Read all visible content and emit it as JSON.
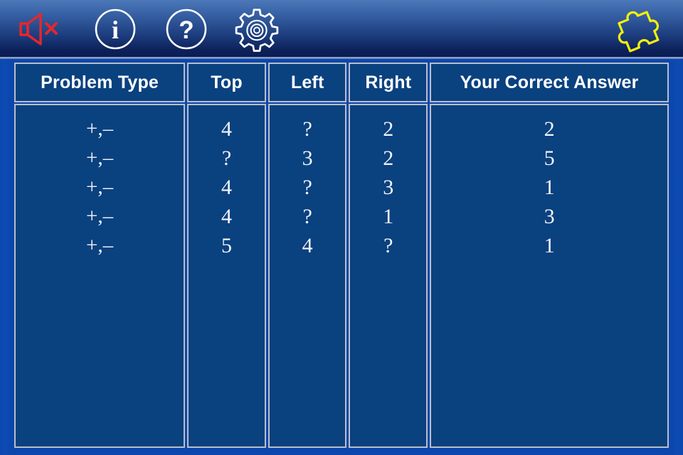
{
  "toolbar": {
    "buttons": [
      {
        "name": "mute-button",
        "icon": "speaker-mute-icon",
        "label": "Sound off",
        "color": "#e8262a"
      },
      {
        "name": "info-button",
        "icon": "info-circle-icon",
        "label": "i",
        "color": "#ffffff"
      },
      {
        "name": "help-button",
        "icon": "question-circle-icon",
        "label": "?",
        "color": "#ffffff"
      },
      {
        "name": "settings-button",
        "icon": "gear-icon",
        "label": "Settings",
        "color": "#ffffff"
      },
      {
        "name": "puzzle-button",
        "icon": "puzzle-piece-icon",
        "label": "Puzzle",
        "color": "#f5f00a"
      }
    ]
  },
  "table": {
    "headers": [
      "Problem Type",
      "Top",
      "Left",
      "Right",
      "Your Correct Answer"
    ],
    "rows": [
      {
        "problem_type": "+,–",
        "top": "4",
        "left": "?",
        "right": "2",
        "answer": "2"
      },
      {
        "problem_type": "+,–",
        "top": "?",
        "left": "3",
        "right": "2",
        "answer": "5"
      },
      {
        "problem_type": "+,–",
        "top": "4",
        "left": "?",
        "right": "3",
        "answer": "1"
      },
      {
        "problem_type": "+,–",
        "top": "4",
        "left": "?",
        "right": "1",
        "answer": "3"
      },
      {
        "problem_type": "+,–",
        "top": "5",
        "left": "4",
        "right": "?",
        "answer": "1"
      }
    ]
  },
  "colors": {
    "page_background": "#0b47ad",
    "panel_background": "#0a417f",
    "cell_border": "#b9bfc6",
    "text": "#ffffff",
    "mute_red": "#e8262a",
    "puzzle_yellow": "#f5f00a"
  }
}
